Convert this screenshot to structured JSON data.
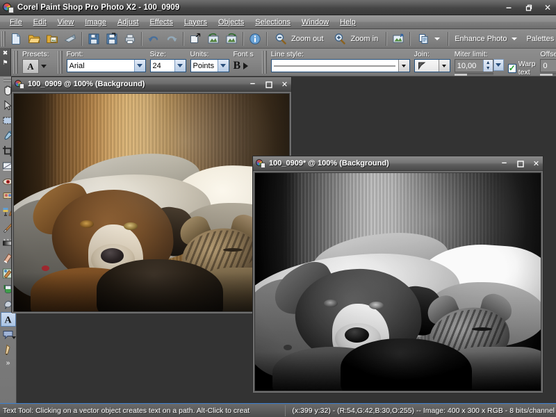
{
  "app": {
    "title": "Corel Paint Shop Pro Photo X2 - 100_0909",
    "icon": "psp-app-icon",
    "window_controls": {
      "minimize": "–",
      "restore": "❐",
      "close": "✕"
    }
  },
  "menubar": {
    "items": [
      {
        "label": "File",
        "accel": "F"
      },
      {
        "label": "Edit",
        "accel": "E"
      },
      {
        "label": "View",
        "accel": "V"
      },
      {
        "label": "Image",
        "accel": "I"
      },
      {
        "label": "Adjust",
        "accel": "A"
      },
      {
        "label": "Effects",
        "accel": "c"
      },
      {
        "label": "Layers",
        "accel": "L"
      },
      {
        "label": "Objects",
        "accel": "O"
      },
      {
        "label": "Selections",
        "accel": "S"
      },
      {
        "label": "Window",
        "accel": "W"
      },
      {
        "label": "Help",
        "accel": "H"
      }
    ]
  },
  "toolbar": {
    "buttons": [
      {
        "name": "new-icon",
        "tooltip": "New"
      },
      {
        "name": "open-icon",
        "tooltip": "Open"
      },
      {
        "name": "browse-icon",
        "tooltip": "Browse"
      },
      {
        "name": "scanner-icon",
        "tooltip": "Import from Scanner"
      },
      {
        "name": "save-icon",
        "tooltip": "Save"
      },
      {
        "name": "save-as-icon",
        "tooltip": "Save As"
      },
      {
        "name": "print-icon",
        "tooltip": "Print"
      },
      {
        "name": "undo-icon",
        "tooltip": "Undo"
      },
      {
        "name": "redo-icon",
        "tooltip": "Redo"
      },
      {
        "name": "resize-icon",
        "tooltip": "Resize"
      },
      {
        "name": "rotate-left-icon",
        "tooltip": "Rotate Left"
      },
      {
        "name": "rotate-right-icon",
        "tooltip": "Rotate Right"
      },
      {
        "name": "info-icon",
        "tooltip": "Image Information"
      }
    ],
    "zoom_out_label": "Zoom out",
    "zoom_in_label": "Zoom in",
    "full_screen_label": "",
    "copy_paste_label": "",
    "enhance_photo_label": "Enhance Photo",
    "enhance_photo_accel": "n",
    "palettes_label": "Palettes",
    "palettes_accel": "P"
  },
  "options_bar": {
    "dock_close": "✖",
    "dock_pin": "⚑",
    "presets_label": "Presets:",
    "preset_value": "A",
    "font_label": "Font:",
    "font_value": "Arial",
    "size_label": "Size:",
    "size_value": "24",
    "units_label": "Units:",
    "units_value": "Points",
    "font_styles_label": "Font s",
    "bold_label": "B",
    "line_style_label": "Line style:",
    "line_style_value": "",
    "join_label": "Join:",
    "miter_limit_label": "Miter limit:",
    "miter_limit_value": "10,00",
    "warp_text_label": "Warp text",
    "warp_text_checked": true,
    "offset_label": "Offset:",
    "offset_value": "0"
  },
  "tool_palette": {
    "tools": [
      {
        "name": "pan-tool",
        "label": "Pan",
        "has_submenu": true,
        "selected": false
      },
      {
        "name": "pick-tool",
        "label": "Pick",
        "has_submenu": true,
        "selected": false
      },
      {
        "name": "selection-tool",
        "label": "Selection",
        "has_submenu": true,
        "selected": false
      },
      {
        "name": "dropper-tool",
        "label": "Dropper",
        "has_submenu": false,
        "selected": false
      },
      {
        "name": "crop-tool",
        "label": "Crop",
        "has_submenu": false,
        "selected": false
      },
      {
        "name": "straighten-tool",
        "label": "Straighten",
        "has_submenu": true,
        "selected": false
      },
      {
        "name": "red-eye-tool",
        "label": "Red Eye",
        "has_submenu": false,
        "selected": false
      },
      {
        "name": "makeover-tool",
        "label": "Makeover",
        "has_submenu": false,
        "selected": false
      },
      {
        "name": "clone-brush-tool",
        "label": "Clone Brush",
        "has_submenu": true,
        "selected": false
      },
      {
        "name": "paint-brush-tool",
        "label": "Paint Brush",
        "has_submenu": true,
        "selected": false
      },
      {
        "name": "gradient-tool",
        "label": "Gradient",
        "has_submenu": true,
        "selected": false
      },
      {
        "name": "eraser-tool",
        "label": "Eraser",
        "has_submenu": false,
        "selected": false
      },
      {
        "name": "color-changer-tool",
        "label": "Color Changer",
        "has_submenu": false,
        "selected": false
      },
      {
        "name": "flood-fill-tool",
        "label": "Flood Fill",
        "has_submenu": true,
        "selected": false
      },
      {
        "name": "smudge-tool",
        "label": "Smudge",
        "has_submenu": false,
        "selected": false
      },
      {
        "name": "text-tool",
        "label": "Text",
        "has_submenu": false,
        "selected": true
      },
      {
        "name": "preset-shape-tool",
        "label": "Preset Shape",
        "has_submenu": true,
        "selected": false
      },
      {
        "name": "pen-tool",
        "label": "Pen",
        "has_submenu": false,
        "selected": false
      }
    ],
    "more_label": "»"
  },
  "image_windows": [
    {
      "title": "100_0909 @ 100% (Background)",
      "active": false,
      "grayscale": false,
      "controls": {
        "minimize": "–",
        "maximize": "❐",
        "close": "✕"
      }
    },
    {
      "title": "100_0909* @ 100% (Background)",
      "active": true,
      "grayscale": true,
      "controls": {
        "minimize": "–",
        "maximize": "❐",
        "close": "✕"
      }
    }
  ],
  "status_bar": {
    "hint": "Text Tool: Clicking on a vector object creates text on a path. Alt-Click to creat",
    "cursor_and_image": "(x:399 y:32) - (R:54,G:42,B:30,O:255) -- Image:  400 x 300 x RGB - 8 bits/channel"
  },
  "colors": {
    "title_bar": "#4a4a4a",
    "menu_bar": "#8c8c8c",
    "toolbar": "#848484",
    "workspace": "#333333",
    "status_accent": "#3a7fd0",
    "selection_highlight": "#aac4e4"
  }
}
